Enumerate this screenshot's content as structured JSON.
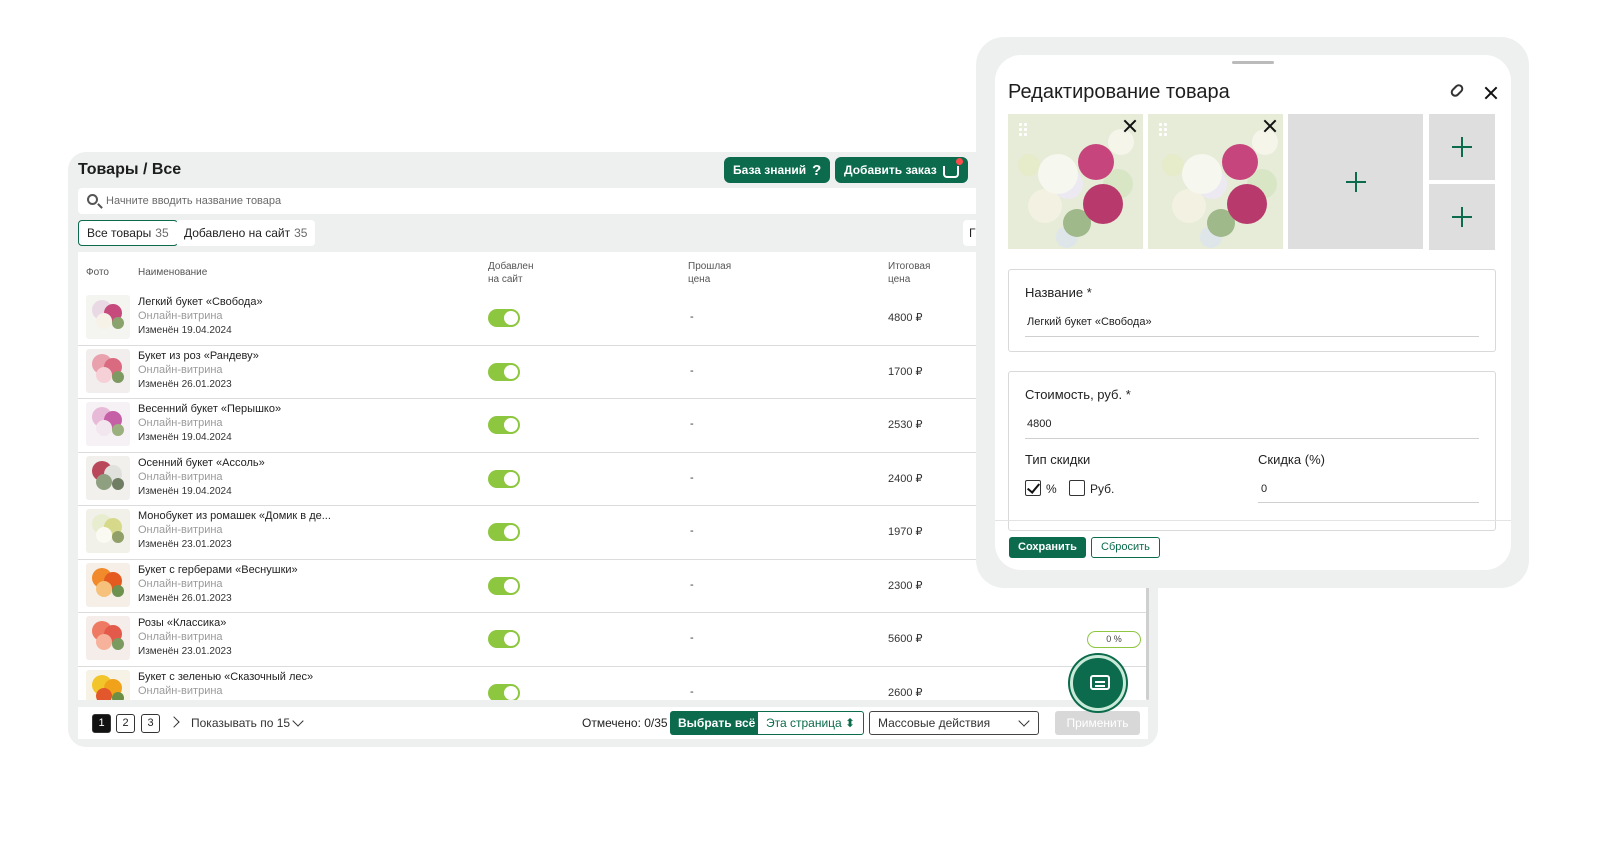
{
  "header": {
    "title": "Товары / Все",
    "knowledge_base_label": "База знаний",
    "add_order_label": "Добавить заказ"
  },
  "search": {
    "placeholder": "Начните вводить название товара"
  },
  "filters": [
    {
      "label": "Все товары",
      "count": "35"
    },
    {
      "label": "Добавлено на сайт",
      "count": "35"
    }
  ],
  "filter_cut_label": "Г",
  "table": {
    "headers": {
      "photo": "Фото",
      "name": "Наименование",
      "added_line1": "Добавлен",
      "added_line2": "на сайт",
      "old_price_line1": "Прошлая",
      "old_price_line2": "цена",
      "final_price_line1": "Итоговая",
      "final_price_line2": "цена"
    },
    "rows": [
      {
        "name": "Легкий букет «Свобода»",
        "showcase": "Онлайн-витрина",
        "modified": "Изменён 19.04.2024",
        "on_site": true,
        "old_price": "-",
        "final_price": "4800 ₽",
        "discount": ""
      },
      {
        "name": "Букет из роз «Рандеву»",
        "showcase": "Онлайн-витрина",
        "modified": "Изменён 26.01.2023",
        "on_site": true,
        "old_price": "-",
        "final_price": "1700 ₽",
        "discount": ""
      },
      {
        "name": "Весенний букет «Перышко»",
        "showcase": "Онлайн-витрина",
        "modified": "Изменён 19.04.2024",
        "on_site": true,
        "old_price": "-",
        "final_price": "2530 ₽",
        "discount": ""
      },
      {
        "name": "Осенний букет «Ассоль»",
        "showcase": "Онлайн-витрина",
        "modified": "Изменён 19.04.2024",
        "on_site": true,
        "old_price": "-",
        "final_price": "2400 ₽",
        "discount": ""
      },
      {
        "name": "Монобукет из ромашек «Домик в де...",
        "showcase": "Онлайн-витрина",
        "modified": "Изменён 23.01.2023",
        "on_site": true,
        "old_price": "-",
        "final_price": "1970 ₽",
        "discount": ""
      },
      {
        "name": "Букет с герберами «Веснушки»",
        "showcase": "Онлайн-витрина",
        "modified": "Изменён 26.01.2023",
        "on_site": true,
        "old_price": "-",
        "final_price": "2300 ₽",
        "discount": ""
      },
      {
        "name": "Розы «Классика»",
        "showcase": "Онлайн-витрина",
        "modified": "Изменён 23.01.2023",
        "on_site": true,
        "old_price": "-",
        "final_price": "5600 ₽",
        "discount": "0 %"
      },
      {
        "name": "Букет с зеленью «Сказочный лес»",
        "showcase": "Онлайн-витрина",
        "modified": "",
        "on_site": true,
        "old_price": "-",
        "final_price": "2600 ₽",
        "discount": ""
      }
    ]
  },
  "pagination": {
    "pages": [
      "1",
      "2",
      "3"
    ],
    "current": "1",
    "per_page_label": "Показывать по 15",
    "marked_label": "Отмечено: 0/35",
    "select_all_label": "Выбрать всё",
    "this_page_label": "Эта страница ⬍",
    "mass_actions_label": "Массовые действия",
    "apply_label": "Применить"
  },
  "edit_card": {
    "title": "Редактирование товара",
    "name_label": "Название *",
    "name_value": "Легкий букет «Свобода»",
    "price_label": "Стоимость, руб. *",
    "price_value": "4800",
    "discount_type_label": "Тип скидки",
    "discount_percent_option": "%",
    "discount_rub_option": "Руб.",
    "discount_percent_checked": true,
    "discount_rub_checked": false,
    "discount_label": "Скидка (%)",
    "discount_value": "0",
    "save_label": "Сохранить",
    "reset_label": "Сбросить"
  },
  "colors": {
    "brand_green": "#0b6b4c",
    "toggle_green": "#8dc63f",
    "panel_bg": "#eef0ef"
  },
  "icons": [
    "search-icon",
    "question-icon",
    "basket-icon",
    "chevron-right-icon",
    "chevron-down-icon",
    "chat-icon",
    "link-icon",
    "close-icon",
    "drag-handle-icon",
    "plus-icon"
  ]
}
